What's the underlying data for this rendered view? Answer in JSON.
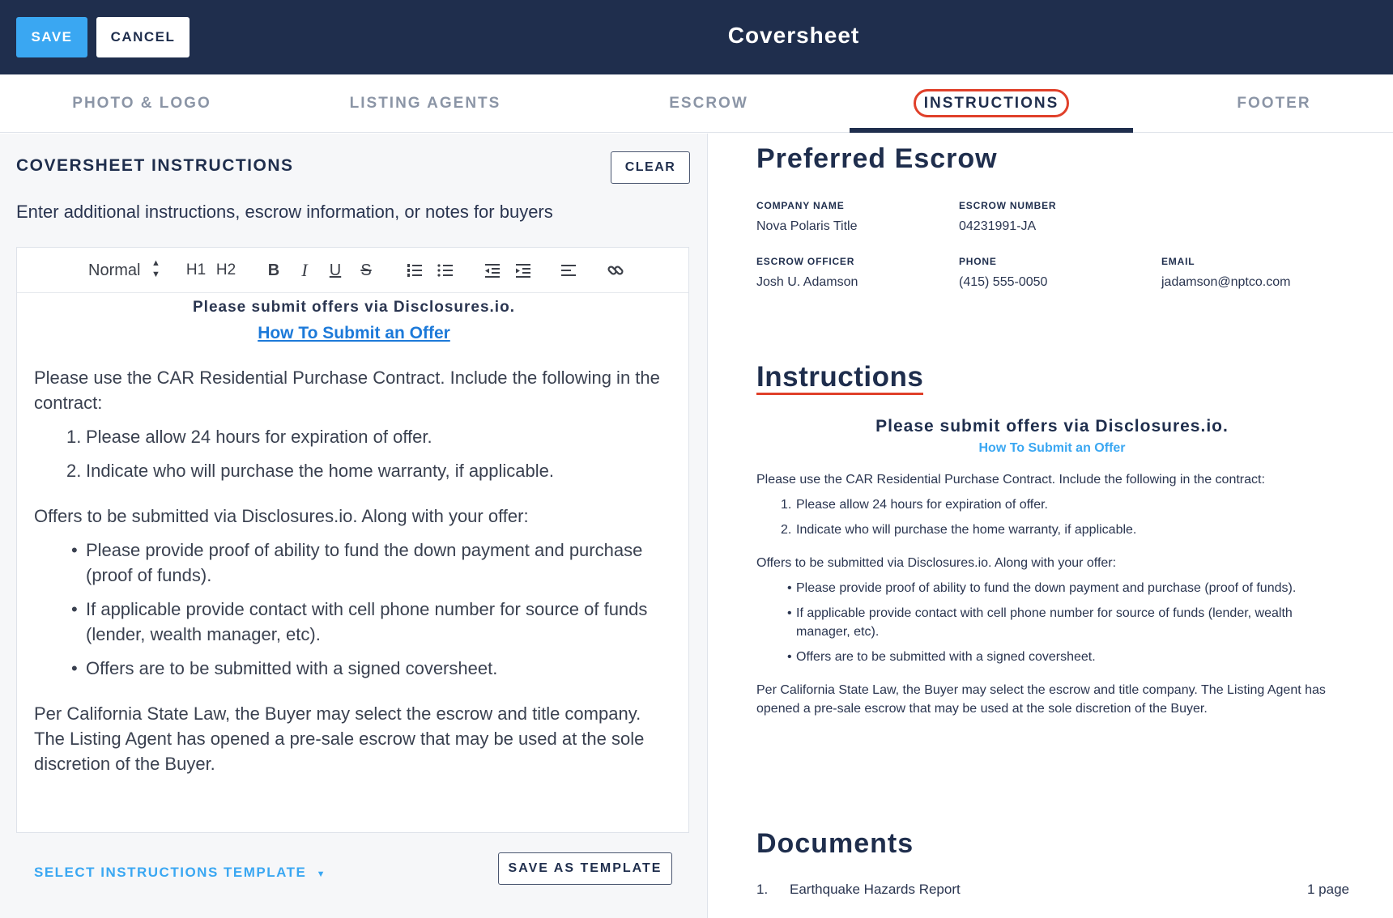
{
  "header": {
    "save_label": "SAVE",
    "cancel_label": "CANCEL",
    "title": "Coversheet"
  },
  "tabs": [
    {
      "label": "PHOTO & LOGO",
      "active": false
    },
    {
      "label": "LISTING AGENTS",
      "active": false
    },
    {
      "label": "ESCROW",
      "active": false
    },
    {
      "label": "INSTRUCTIONS",
      "active": true
    },
    {
      "label": "FOOTER",
      "active": false
    }
  ],
  "left": {
    "section_title": "COVERSHEET INSTRUCTIONS",
    "clear_label": "CLEAR",
    "subtitle": "Enter additional instructions, escrow information, or notes for buyers",
    "toolbar": {
      "format_select": "Normal",
      "h1": "H1",
      "h2": "H2"
    },
    "editor": {
      "heading": "Please submit offers via Disclosures.io.",
      "link": "How To Submit an Offer",
      "para1": "Please use the CAR Residential Purchase Contract. Include the following in the contract:",
      "ol": [
        "Please allow 24 hours for expiration of offer.",
        "Indicate who will purchase the home warranty, if applicable."
      ],
      "para2": "Offers to be submitted via Disclosures.io. Along with your offer:",
      "ul": [
        "Please provide proof of ability to fund the down payment and purchase (proof of funds).",
        "If applicable provide contact with cell phone number for source of funds (lender, wealth manager, etc).",
        "Offers are to be submitted with a signed coversheet."
      ],
      "para3": "Per California State Law, the Buyer may select the escrow and title company. The Listing Agent has opened a pre-sale escrow that may be used at the sole discretion of the Buyer."
    },
    "select_template_label": "SELECT INSTRUCTIONS TEMPLATE",
    "save_template_label": "SAVE AS TEMPLATE"
  },
  "preview": {
    "escrow_title": "Preferred Escrow",
    "company_name_label": "COMPANY NAME",
    "company_name": "Nova Polaris Title",
    "escrow_number_label": "ESCROW NUMBER",
    "escrow_number": "04231991-JA",
    "officer_label": "ESCROW OFFICER",
    "officer": "Josh U. Adamson",
    "phone_label": "PHONE",
    "phone": "(415) 555-0050",
    "email_label": "EMAIL",
    "email": "jadamson@nptco.com",
    "instructions_title": "Instructions",
    "documents_title": "Documents",
    "documents": [
      {
        "number": "1.",
        "name": "Earthquake Hazards Report",
        "pages": "1 page"
      }
    ]
  },
  "colors": {
    "header_bg": "#1f2e4d",
    "accent": "#3aa7f2",
    "highlight": "#e0402a",
    "link": "#1d7ad9"
  },
  "icons": [
    "format-select-arrows-icon",
    "bold-icon",
    "italic-icon",
    "underline-icon",
    "strikethrough-icon",
    "ordered-list-icon",
    "bullet-list-icon",
    "outdent-icon",
    "indent-icon",
    "align-left-icon",
    "link-icon",
    "caret-down-icon"
  ]
}
